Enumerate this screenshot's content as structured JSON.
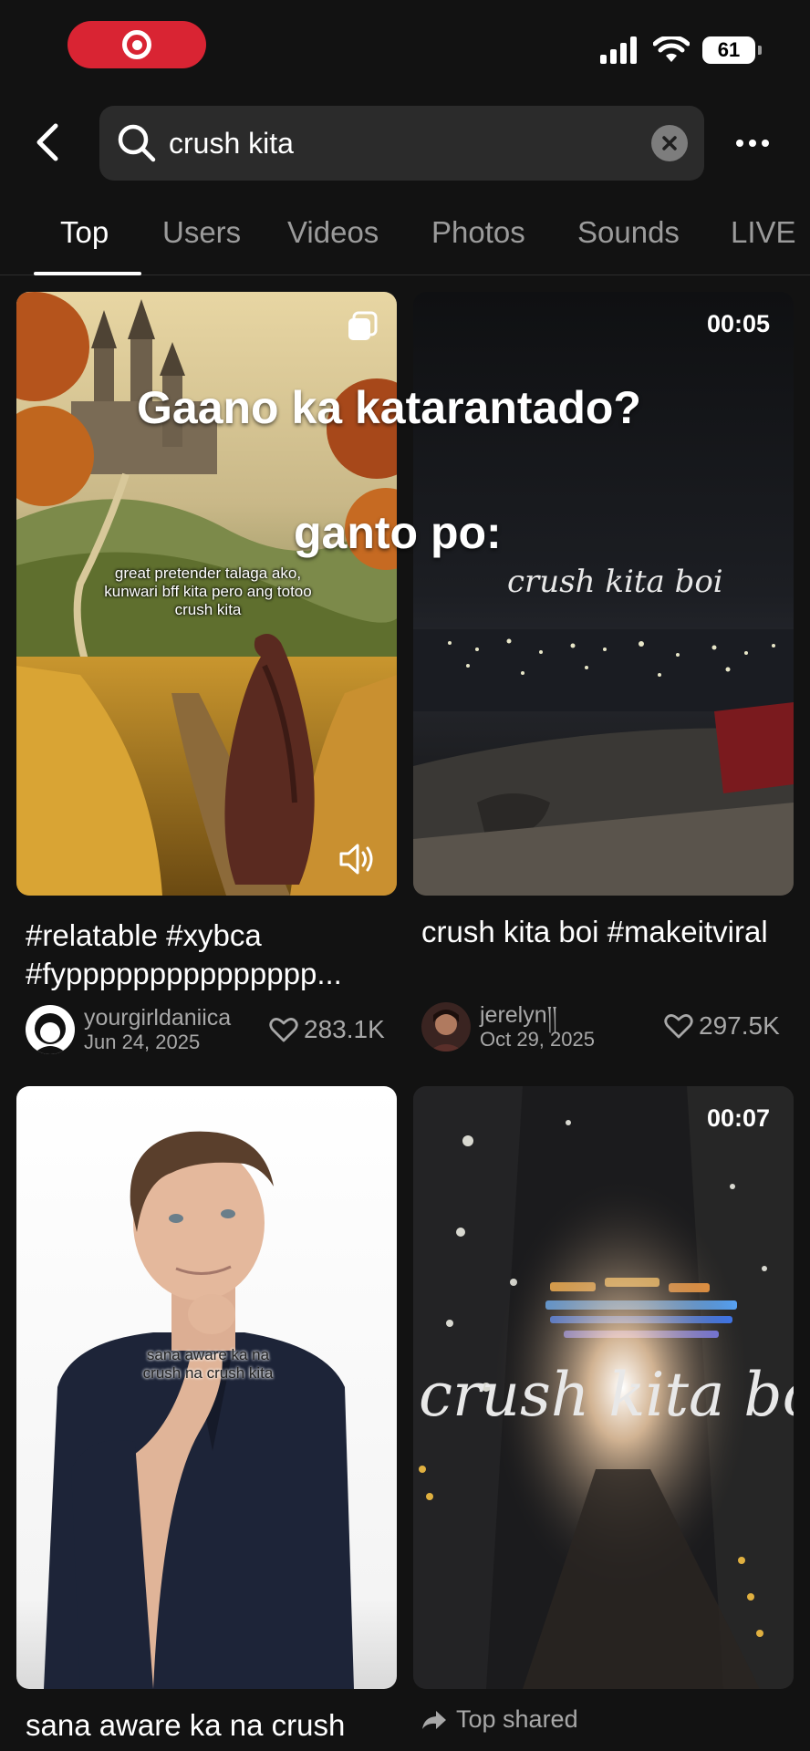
{
  "status_bar": {
    "battery": "61"
  },
  "search": {
    "query": "crush kita"
  },
  "tabs": [
    "Top",
    "Users",
    "Videos",
    "Photos",
    "Sounds",
    "LIVE"
  ],
  "overlay": {
    "line1": "Gaano ka katarantado?",
    "line2": "ganto po:"
  },
  "cards": [
    {
      "caption_overlay": "great pretender talaga ako, kunwari bff kita pero ang totoo crush kita",
      "description": "#relatable #xybca #fyppppppppppppppp...",
      "username": "yourgirldaniica",
      "date": "Jun 24, 2025",
      "likes": "283.1K"
    },
    {
      "duration": "00:05",
      "script_text": "crush kita boi",
      "description": "crush kita boi #makeitviral",
      "username": "jerelyn།།",
      "date": "Oct 29, 2025",
      "likes": "297.5K"
    },
    {
      "caption_overlay": "sana aware ka na crush na crush kita",
      "description": "sana aware ka na crush"
    },
    {
      "duration": "00:07",
      "script_text": "crush kita boi",
      "badge": "Top shared"
    }
  ]
}
